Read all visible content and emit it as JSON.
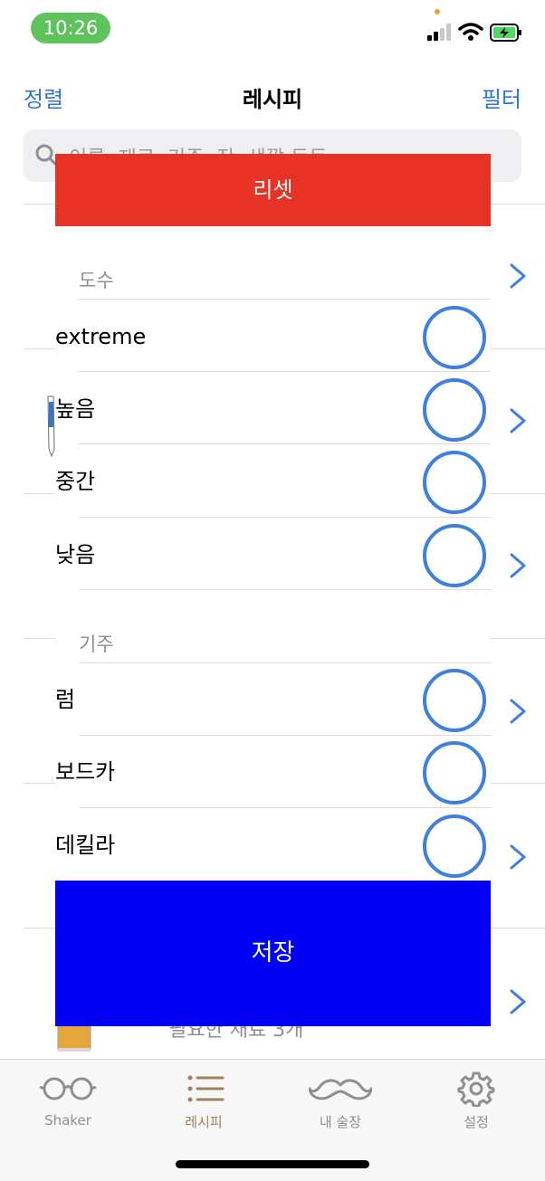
{
  "status": {
    "time": "10:26"
  },
  "nav": {
    "left": "정렬",
    "title": "레시피",
    "right": "필터"
  },
  "search": {
    "placeholder": "이름, 재료, 기주, 잔, 색깔 등등"
  },
  "background": {
    "row_subtitle": "필요한 재료 3개"
  },
  "overlay": {
    "reset_label": "리셋",
    "save_label": "저장",
    "sections": [
      {
        "title": "도수",
        "options": [
          "extreme",
          "높음",
          "중간",
          "낮음"
        ]
      },
      {
        "title": "기주",
        "options": [
          "럼",
          "보드카",
          "데킬라"
        ]
      }
    ]
  },
  "tabs": [
    {
      "label": "Shaker",
      "icon": "glasses-icon",
      "active": false
    },
    {
      "label": "레시피",
      "icon": "list-icon",
      "active": true
    },
    {
      "label": "내 술장",
      "icon": "mustache-icon",
      "active": false
    },
    {
      "label": "설정",
      "icon": "gear-icon",
      "active": false
    }
  ],
  "colors": {
    "accent": "#2f76d2",
    "reset": "#e63325",
    "save": "#0000f5",
    "radio": "#3f7fdd",
    "tab_active": "#a0805e",
    "time_pill": "#5dc35a"
  }
}
